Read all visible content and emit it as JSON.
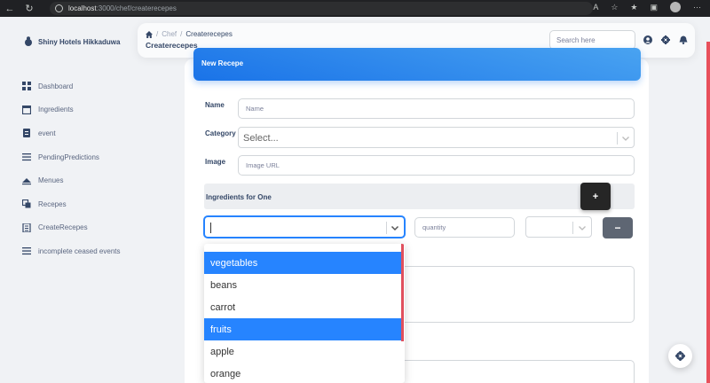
{
  "browser": {
    "url_host": "localhost",
    "url_path": ":3000/chef/createrecepes"
  },
  "sidebar": {
    "brand": "Shiny Hotels Hikkaduwa",
    "items": [
      {
        "label": "Dashboard",
        "icon": "dashboard-icon"
      },
      {
        "label": "Ingredients",
        "icon": "table-icon"
      },
      {
        "label": "event",
        "icon": "receipt-icon"
      },
      {
        "label": "PendingPredictions",
        "icon": "list-icon"
      },
      {
        "label": "Menues",
        "icon": "menu-icon"
      },
      {
        "label": "Recepes",
        "icon": "copy-icon"
      },
      {
        "label": "CreateRecepes",
        "icon": "form-icon"
      },
      {
        "label": "incomplete ceased events",
        "icon": "list-icon"
      }
    ]
  },
  "header": {
    "breadcrumb": [
      "Chef",
      "Createrecepes"
    ],
    "title": "Createrecepes",
    "search_placeholder": "Search here"
  },
  "form": {
    "card_title": "New Recepe",
    "name_label": "Name",
    "name_placeholder": "Name",
    "category_label": "Category",
    "category_value": "Select...",
    "image_label": "Image",
    "image_placeholder": "Image URL",
    "ingredients_title": "Ingredients for One",
    "add_label": "+",
    "remove_label": "−",
    "quantity_placeholder": "quantity"
  },
  "dropdown": {
    "options": [
      {
        "label": "vegetables",
        "selected": true
      },
      {
        "label": "beans",
        "selected": false
      },
      {
        "label": "carrot",
        "selected": false
      },
      {
        "label": "fruits",
        "selected": true
      },
      {
        "label": "apple",
        "selected": false
      },
      {
        "label": "orange",
        "selected": false
      }
    ]
  },
  "colors": {
    "accent": "#1a73e8",
    "option_highlight": "#2684ff",
    "side_accent": "#e8505b"
  }
}
